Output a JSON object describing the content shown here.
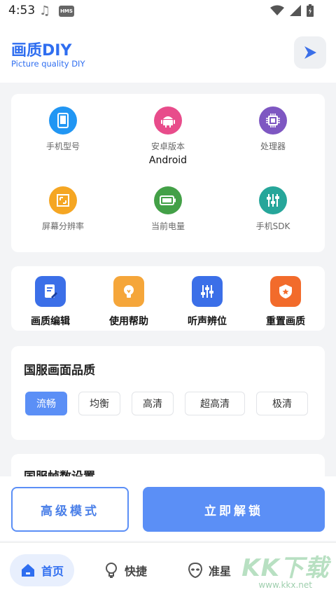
{
  "status": {
    "time": "4:53",
    "badge": "HMS"
  },
  "header": {
    "title": "画质DIY",
    "subtitle": "Picture quality DIY"
  },
  "info": [
    {
      "label": "手机型号",
      "value": "",
      "icon": "phone-icon",
      "color": "#2196f3"
    },
    {
      "label": "安卓版本",
      "value": "Android",
      "icon": "android-icon",
      "color": "#e84c8b"
    },
    {
      "label": "处理器",
      "value": "",
      "icon": "cpu-icon",
      "color": "#7e57c2"
    },
    {
      "label": "屏幕分辨率",
      "value": "",
      "icon": "resolution-icon",
      "color": "#f5a623"
    },
    {
      "label": "当前电量",
      "value": "",
      "icon": "battery-icon",
      "color": "#43a047"
    },
    {
      "label": "手机SDK",
      "value": "",
      "icon": "sdk-icon",
      "color": "#26a69a"
    }
  ],
  "tools": [
    {
      "label": "画质编辑",
      "icon": "edit-icon",
      "color": "#3b6fe8"
    },
    {
      "label": "使用帮助",
      "icon": "bulb-icon",
      "color": "#f5a63a"
    },
    {
      "label": "听声辨位",
      "icon": "equalizer-icon",
      "color": "#3b6fe8"
    },
    {
      "label": "重置画质",
      "icon": "shield-icon",
      "color": "#f26b2b"
    }
  ],
  "quality": {
    "title": "国服画面品质",
    "options": [
      "流畅",
      "均衡",
      "高清",
      "超高清",
      "极清"
    ],
    "selected": "流畅"
  },
  "fps": {
    "title": "国服帧数设置"
  },
  "actions": {
    "advanced": "高级模式",
    "unlock": "立即解锁"
  },
  "nav": {
    "home": "首页",
    "quick": "快捷",
    "aim": "准星"
  },
  "watermark": {
    "main": "KK下载",
    "sub": "www.kkx.net"
  }
}
